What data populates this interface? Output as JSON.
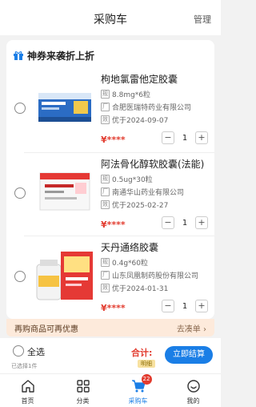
{
  "header": {
    "title": "采购车",
    "manage": "管理"
  },
  "coupon": {
    "text": "神券来袭折上折"
  },
  "items": [
    {
      "name": "枸地氯雷他定胶囊",
      "spec": "8.8mg*6粒",
      "manufacturer": "合肥医瑞特药业有限公司",
      "expiry": "优于2024-09-07",
      "price": "¥****",
      "qty": "1",
      "spec_tag": "规",
      "mfr_tag": "厂",
      "exp_tag": "效"
    },
    {
      "name": "阿法骨化醇软胶囊(法能)",
      "spec": "0.5ug*30粒",
      "manufacturer": "南通华山药业有限公司",
      "expiry": "优于2025-02-27",
      "price": "¥****",
      "qty": "1",
      "spec_tag": "规",
      "mfr_tag": "厂",
      "exp_tag": "效"
    },
    {
      "name": "天丹通络胶囊",
      "spec": "0.4g*60粒",
      "manufacturer": "山东凤凰制药股份有限公司",
      "expiry": "优于2024-01-31",
      "price": "¥****",
      "qty": "1",
      "spec_tag": "规",
      "mfr_tag": "厂",
      "exp_tag": "效"
    }
  ],
  "stepper": {
    "minus": "−",
    "plus": "+"
  },
  "promo": {
    "left": "再购商品可再优惠",
    "right": "去凑单 ›"
  },
  "checkout": {
    "select_all": "全选",
    "selected_count": "已选择1件",
    "total_label": "合计:",
    "total_hint": "明细",
    "pay_button": "立即结算"
  },
  "tabbar": {
    "tabs": [
      {
        "label": "首页",
        "icon": "home-icon"
      },
      {
        "label": "分类",
        "icon": "category-icon"
      },
      {
        "label": "采购车",
        "icon": "cart-icon",
        "badge": "22"
      },
      {
        "label": "我的",
        "icon": "user-icon"
      }
    ]
  },
  "colors": {
    "accent": "#1a7ee6",
    "price": "#e23b2e",
    "promo_bg": "#fdeadb"
  }
}
